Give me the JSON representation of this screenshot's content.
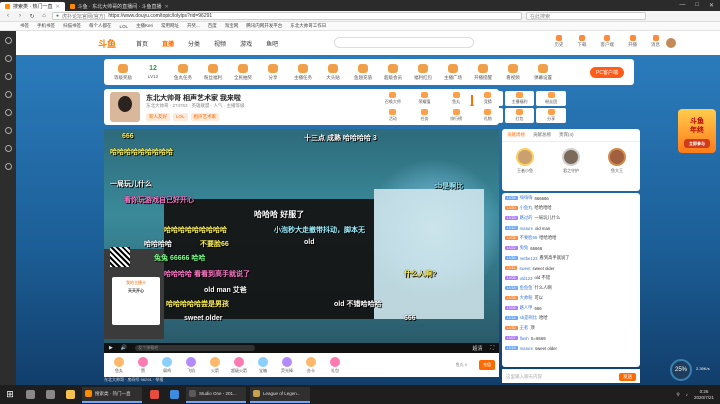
{
  "browser": {
    "tabs": [
      {
        "title": "搜索类 · 热门一直",
        "active": true
      },
      {
        "title": "斗鱼 · 东北大帅哥的直播间 · 斗鱼直播",
        "active": false
      }
    ],
    "window_controls": [
      "—",
      "□",
      "✕"
    ],
    "url_site": "虎扑论坛官网(官方)",
    "url": "https://www.douyu.com/topic/lolylps?rid=96291",
    "search_placeholder": "在此搜索",
    "bookmarks": [
      "书签",
      "手机书签",
      "扫描书签",
      "每个人都在",
      "LOL",
      "主播Keri",
      "常用网址",
      "开奖...",
      "百度",
      "淘宝网",
      "腾讯内网开发平台",
      "东北大帅哥工作日"
    ]
  },
  "site": {
    "logo": "斗鱼",
    "nav": [
      "首页",
      "直播",
      "分类",
      "视频",
      "游戏",
      "鱼吧"
    ],
    "nav_active": "直播",
    "search_placeholder": "",
    "user_tools": [
      "历史",
      "下载",
      "客户端",
      "开播",
      "消息"
    ]
  },
  "toolbar": {
    "items": [
      "等级奖励",
      "LV12",
      "鱼丸任务",
      "粉丝福利",
      "全民抽奖",
      "分享",
      "主播任务",
      "大头贴",
      "鱼翅充值",
      "超级会员",
      "福利红包",
      "主播广场",
      "开播提醒",
      "看视频",
      "弹幕设置",
      "录屏",
      "更多"
    ],
    "level": "12",
    "pc_button": "PC客户端"
  },
  "room": {
    "title": "东北大帅哥 相声艺术家 我来啦",
    "meta": "东北大帅哥  ·  274763  ·  英雄联盟  ·  人气  ·  主播等级",
    "tags": [
      "新人友好",
      "LOL",
      "相声艺术家"
    ],
    "follow": "+ 关注 7.2万",
    "report": "举报"
  },
  "room_tools": [
    "召唤大师",
    "荣耀值",
    "鱼丸",
    "竞猜",
    "主播福利",
    "粉丝团",
    "活动",
    "任务",
    "排行榜",
    "礼物",
    "红包",
    "分享"
  ],
  "video": {
    "danmu": [
      {
        "text": "666",
        "style": "y"
      },
      {
        "text": "十三点  成熟  哈哈哈哈  3",
        "style": ""
      },
      {
        "text": "哈哈哈哈哈哈哈哈哈",
        "style": "y"
      },
      {
        "text": "一局玩儿什么",
        "style": ""
      },
      {
        "text": "看你玩游戏自己好开心",
        "style": "p"
      },
      {
        "text": "哈哈哈  好服了",
        "style": "big"
      },
      {
        "text": "哈哈哈哈哈哈哈哈哈",
        "style": "y"
      },
      {
        "text": "小泡秒大走撤带抖动，脚本无",
        "style": "c"
      },
      {
        "text": "哈哈哈哈",
        "style": ""
      },
      {
        "text": "不要脸66",
        "style": "y"
      },
      {
        "text": "old",
        "style": ""
      },
      {
        "text": "兔兔  66666  哈哈",
        "style": "g"
      },
      {
        "text": "哈哈哈哈  看看到高手就说了",
        "style": "p"
      },
      {
        "text": "old man  艾爸",
        "style": ""
      },
      {
        "text": "哈哈哈哈哈尝是男孩",
        "style": "y"
      },
      {
        "text": "sweet older",
        "style": ""
      },
      {
        "text": "sb是啊比",
        "style": "c"
      },
      {
        "text": "666",
        "style": ""
      },
      {
        "text": "什么人啊?",
        "style": "y"
      },
      {
        "text": "old  不错哈哈哈",
        "style": ""
      }
    ],
    "cam_card_title": "我的主播卡",
    "cam_card_sub": "天天开心",
    "controls": {
      "play": "▶",
      "input_placeholder": "发个弹幕吧",
      "quality": "超清",
      "fullscreen": "⛶",
      "volume": "🔊"
    }
  },
  "gifts": [
    "鱼丸",
    "赞",
    "弱鸡",
    "飞机",
    "火箭",
    "超级火箭",
    "宝箱",
    "荧光棒",
    "办卡",
    "礼包"
  ],
  "gift_extra": {
    "fish": "鱼丸 0",
    "charge": "充值"
  },
  "bottom_info": "东北大帅哥  ·  房间号 96291  ·  举报",
  "rank": {
    "tabs": [
      "贡献周榜",
      "贡献总榜",
      "贵宾(4)"
    ],
    "users": [
      "王者小鱼",
      "君之守护",
      "鱼大王"
    ]
  },
  "chat": [
    {
      "badge": "LV36",
      "user": "嗨嗨嗨",
      "msg": "666666",
      "b": "b2"
    },
    {
      "badge": "LV20",
      "user": "小鱼丸",
      "msg": "哈哈哈哈",
      "b": ""
    },
    {
      "badge": "LV15",
      "user": "路过的",
      "msg": "一局玩儿什么",
      "b": "b3"
    },
    {
      "badge": "LV12",
      "user": "mature",
      "msg": "old man",
      "b": "b2"
    },
    {
      "badge": "LV08",
      "user": "不要脸66",
      "msg": "哈哈哈哈",
      "b": ""
    },
    {
      "badge": "LV22",
      "user": "兔兔",
      "msg": "66666",
      "b": "b3"
    },
    {
      "badge": "LV30",
      "user": "netbe123",
      "msg": "看到高手就说了",
      "b": "b2"
    },
    {
      "badge": "LV11",
      "user": "sweet",
      "msg": "sweet older",
      "b": ""
    },
    {
      "badge": "LV05",
      "user": "old123",
      "msg": "old 不错",
      "b": "b3"
    },
    {
      "badge": "LV18",
      "user": "鱼鱼鱼",
      "msg": "什么人啊",
      "b": "b2"
    },
    {
      "badge": "LV26",
      "user": "大帅粉",
      "msg": "可以",
      "b": ""
    },
    {
      "badge": "LV09",
      "user": "路人甲",
      "msg": "666",
      "b": "b3"
    },
    {
      "badge": "LV14",
      "user": "sb是啊比",
      "msg": "哈哈",
      "b": "b2"
    },
    {
      "badge": "LV32",
      "user": "王者",
      "msg": "顶",
      "b": ""
    },
    {
      "badge": "LV07",
      "user": "flash",
      "msg": "S=6569",
      "b": "b3"
    },
    {
      "badge": "LV19",
      "user": "mature",
      "msg": "sweet older",
      "b": "b2"
    }
  ],
  "chat_input": {
    "placeholder": "这里输入聊天内容",
    "send": "发送"
  },
  "promo": {
    "text": "斗鱼\n年终",
    "sub": "立即参与"
  },
  "float_bubble": {
    "value": "25",
    "unit": "%",
    "label": "2.39K/s"
  },
  "taskbar": {
    "apps": [
      "搜索类 · 热门一直",
      "Studio One - 201...",
      "League of Legen..."
    ],
    "time": "0:26",
    "date": "2020/7/21"
  }
}
